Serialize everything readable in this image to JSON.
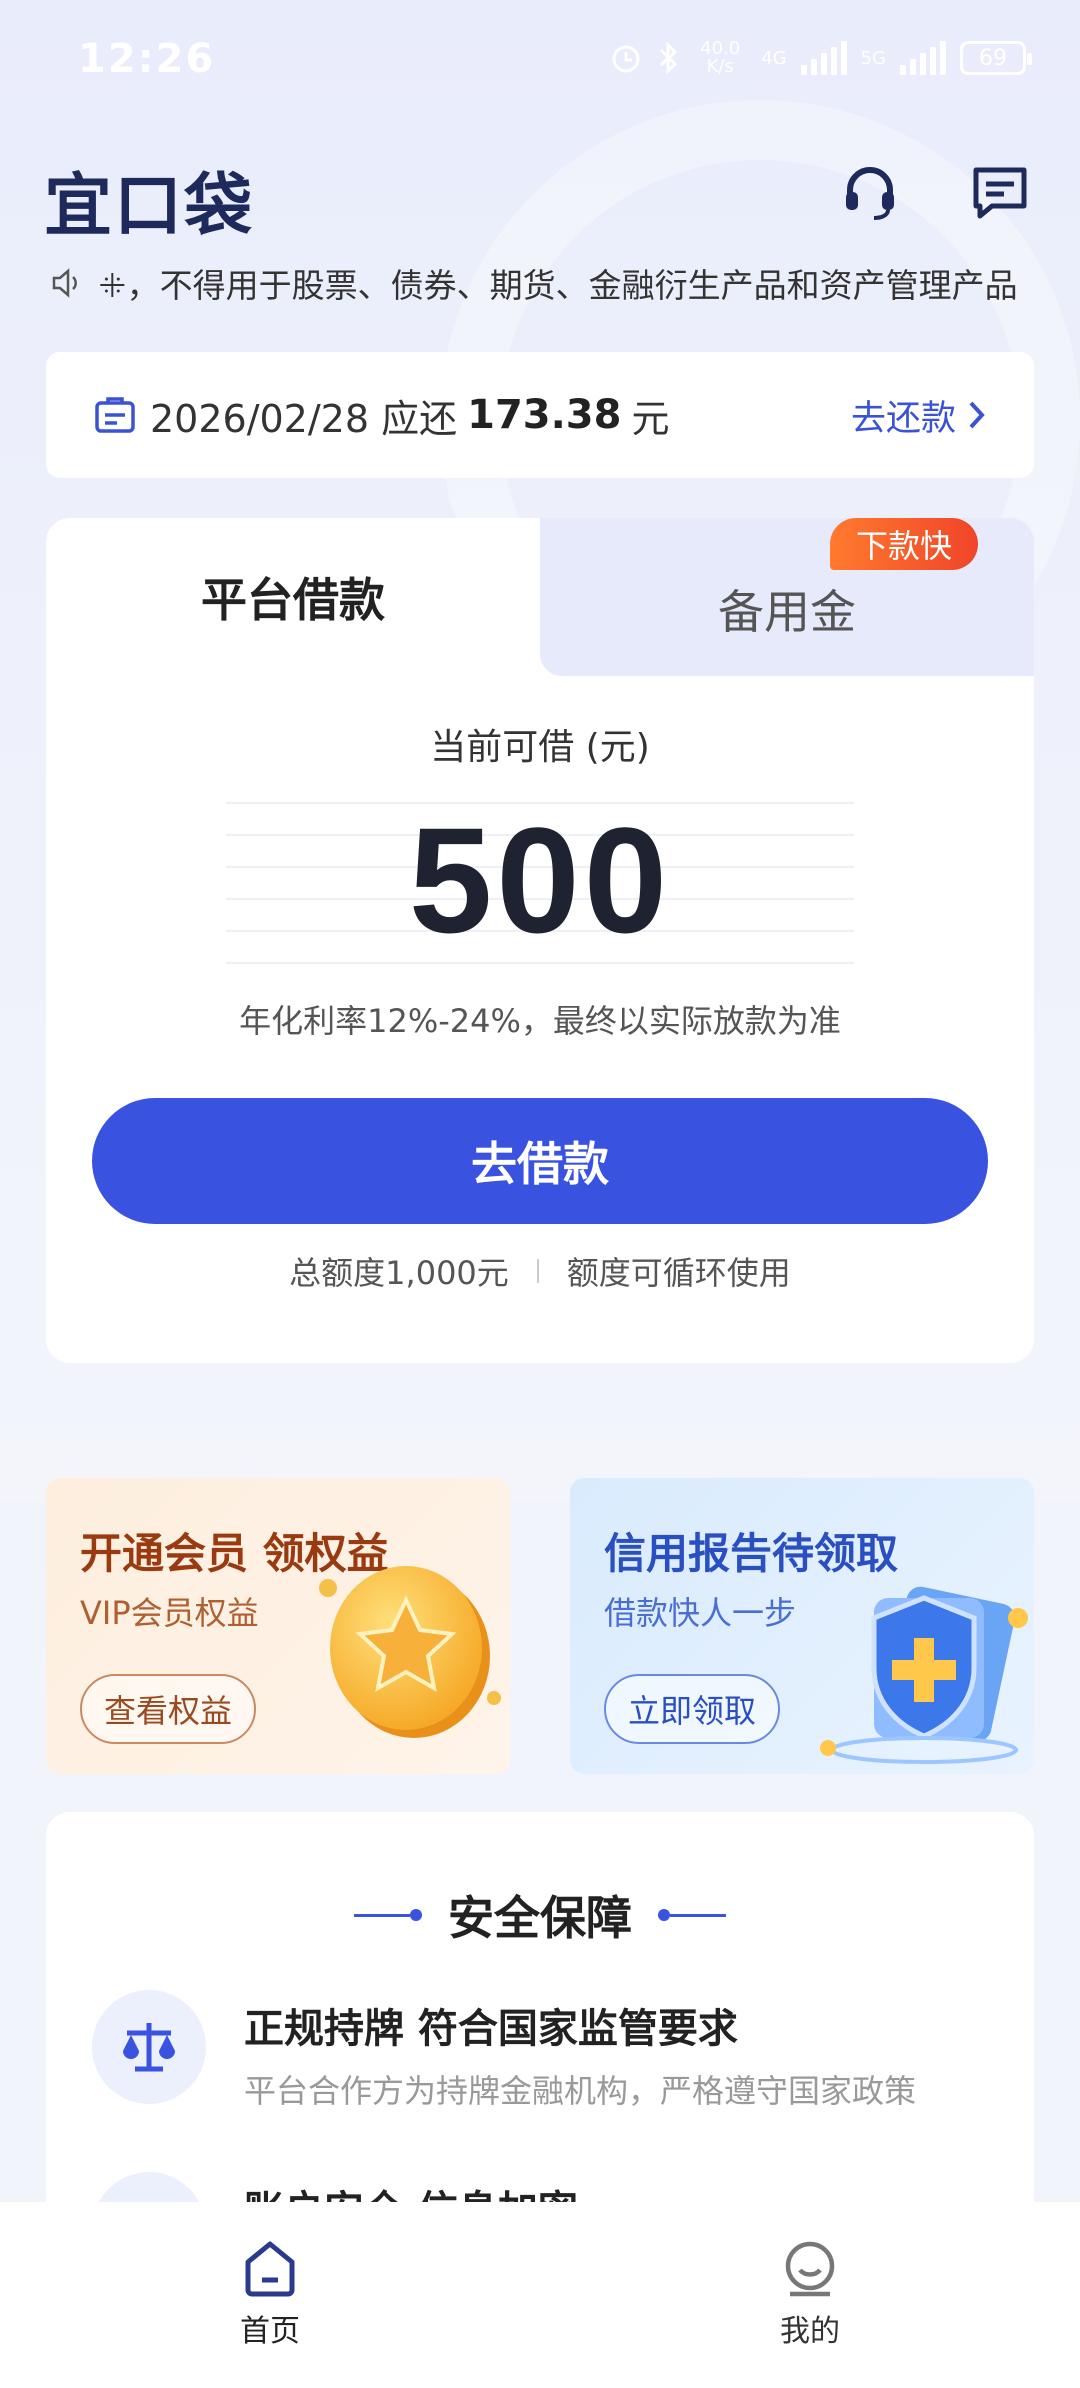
{
  "status_bar": {
    "time": "12:26",
    "net_speed": "40.0 K/s",
    "net_4g": "4G",
    "net_5g": "5G",
    "battery": "69"
  },
  "header": {
    "logo": "宜口袋"
  },
  "notice": {
    "text": "ꔰ，不得用于股票、债券、期货、金融衍生产品和资产管理产品"
  },
  "repayment": {
    "date_text": "2026/02/28 应还",
    "amount": "173.38",
    "unit": "元",
    "action": "去还款"
  },
  "loan_card": {
    "tabs": [
      {
        "label": "平台借款",
        "active": true
      },
      {
        "label": "备用金",
        "active": false
      }
    ],
    "badge": "下款快",
    "available_label": "当前可借 (元)",
    "available_amount": "500",
    "rate_text": "年化利率12%-24%，最终以实际放款为准",
    "borrow_button": "去借款",
    "total_quota": "总额度1,000元",
    "quota_note": "额度可循环使用"
  },
  "promos": [
    {
      "title": "开通会员 领权益",
      "subtitle": "VIP会员权益",
      "button": "查看权益"
    },
    {
      "title": "信用报告待领取",
      "subtitle": "借款快人一步",
      "button": "立即领取"
    }
  ],
  "safety": {
    "title": "安全保障",
    "features": [
      {
        "title": "正规持牌 符合国家监管要求",
        "desc": "平台合作方为持牌金融机构，严格遵守国家政策",
        "icon": "scale-icon"
      },
      {
        "title": "账户安全 信息加密",
        "desc": "",
        "icon": "shield-icon"
      }
    ]
  },
  "bottom_nav": [
    {
      "label": "首页",
      "icon": "home-icon",
      "active": true
    },
    {
      "label": "我的",
      "icon": "profile-icon",
      "active": false
    }
  ],
  "colors": {
    "primary": "#3a52e0",
    "badge": "#f0452a",
    "background": "#f2f4fb"
  }
}
